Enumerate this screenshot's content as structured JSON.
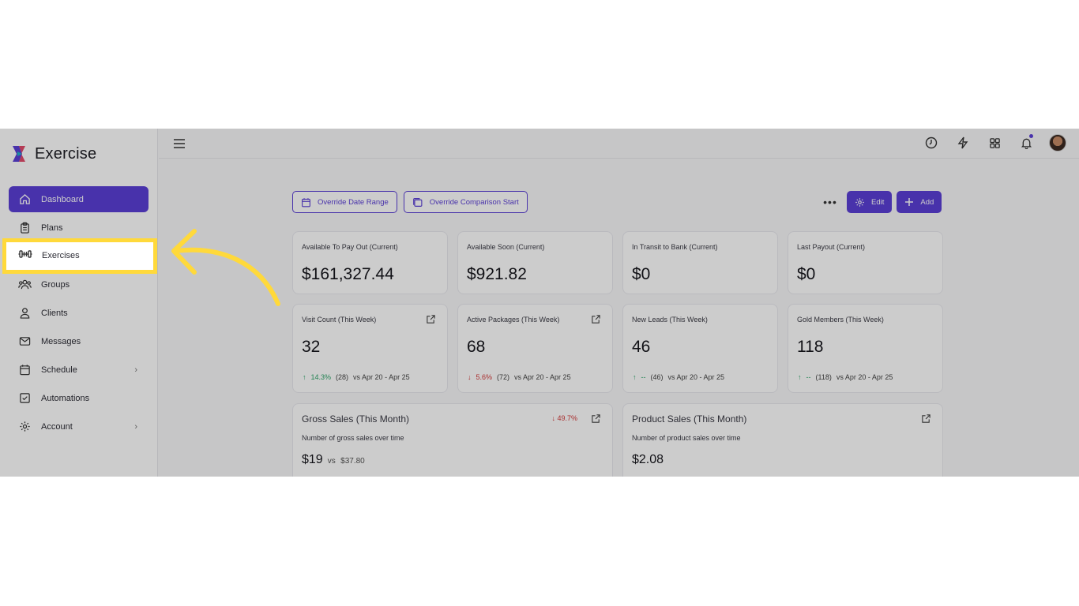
{
  "app": {
    "title": "Exercise"
  },
  "sidebar": {
    "items": [
      {
        "label": "Dashboard",
        "icon": "home-icon",
        "active": true
      },
      {
        "label": "Plans",
        "icon": "clipboard-icon"
      },
      {
        "label": "Exercises",
        "icon": "dumbbell-icon"
      },
      {
        "label": "Groups",
        "icon": "users-icon"
      },
      {
        "label": "Clients",
        "icon": "user-icon"
      },
      {
        "label": "Messages",
        "icon": "mail-icon"
      },
      {
        "label": "Schedule",
        "icon": "calendar-icon",
        "chevron": true
      },
      {
        "label": "Automations",
        "icon": "checkbox-icon"
      },
      {
        "label": "Account",
        "icon": "gear-icon",
        "chevron": true
      }
    ]
  },
  "toolbar": {
    "override_date_range": "Override Date Range",
    "override_comparison_start": "Override Comparison Start",
    "more": "•••",
    "edit": "Edit",
    "add": "Add"
  },
  "stats_row1": [
    {
      "label": "Available To Pay Out (Current)",
      "value": "$161,327.44"
    },
    {
      "label": "Available Soon (Current)",
      "value": "$921.82"
    },
    {
      "label": "In Transit to Bank (Current)",
      "value": "$0"
    },
    {
      "label": "Last Payout (Current)",
      "value": "$0"
    }
  ],
  "stats_row2": [
    {
      "label": "Visit Count (This Week)",
      "value": "32",
      "arrow": "↑",
      "pct": "14.3%",
      "prev": "(28)",
      "range": "vs Apr 20 - Apr 25"
    },
    {
      "label": "Active Packages (This Week)",
      "value": "68",
      "arrow": "↓",
      "pct": "5.6%",
      "prev": "(72)",
      "range": "vs Apr 20 - Apr 25"
    },
    {
      "label": "New Leads (This Week)",
      "value": "46",
      "arrow": "↑",
      "pct": "--",
      "prev": "(46)",
      "range": "vs Apr 20 - Apr 25"
    },
    {
      "label": "Gold Members (This Week)",
      "value": "118",
      "arrow": "↑",
      "pct": "--",
      "prev": "(118)",
      "range": "vs Apr 20 - Apr 25"
    }
  ],
  "gross_sales": {
    "title": "Gross Sales (This Month)",
    "subtitle": "Number of gross sales over time",
    "value": "$19",
    "vs_label": "vs",
    "vs_value": "$37.80",
    "change": "↓ 49.7%"
  },
  "product_sales": {
    "title": "Product Sales (This Month)",
    "subtitle": "Number of product sales over time",
    "value": "$2.08"
  },
  "colors": {
    "accent": "#5b3fd6",
    "highlight": "#ffd93b",
    "up": "#2fa56a",
    "down": "#d43a3a"
  }
}
